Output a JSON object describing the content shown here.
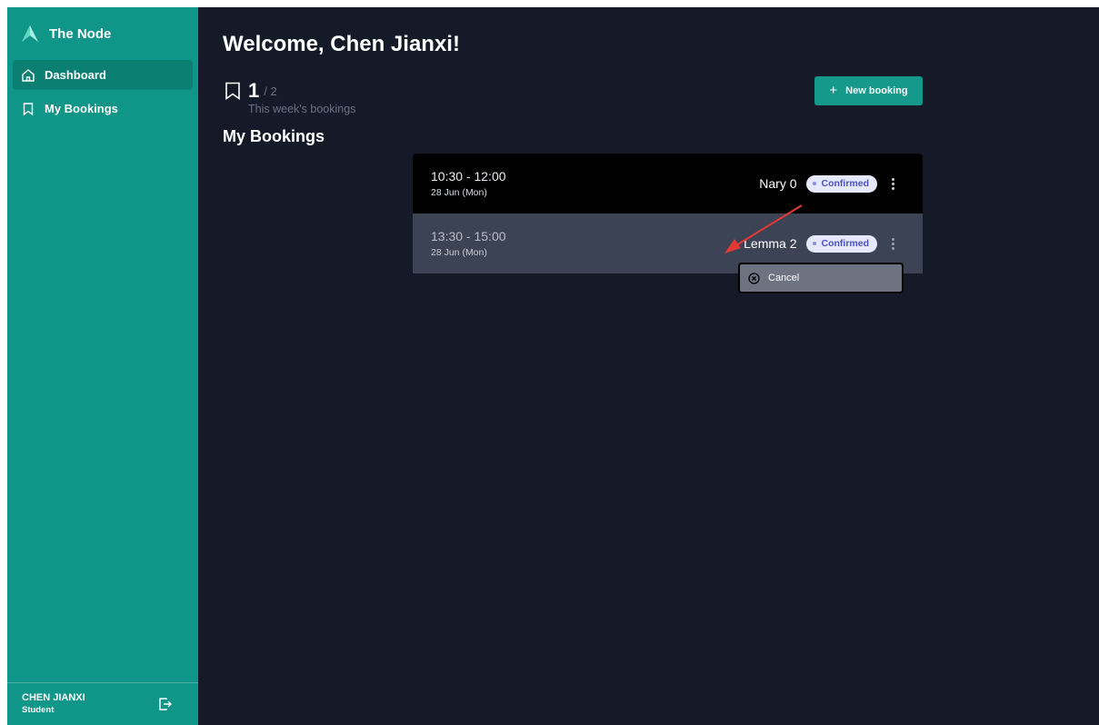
{
  "app": {
    "name": "The Node",
    "logo_icon": "a-logo-icon"
  },
  "sidebar": {
    "items": [
      {
        "label": "Dashboard",
        "icon": "home-icon",
        "active": true
      },
      {
        "label": "My Bookings",
        "icon": "bookmark-icon",
        "active": false
      }
    ],
    "user": {
      "name": "CHEN JIANXI",
      "role": "Student"
    },
    "logout_icon": "logout-icon"
  },
  "main": {
    "welcome": "Welcome, Chen Jianxi!",
    "stats": {
      "count": "1",
      "total": "/ 2",
      "caption": "This week's bookings"
    },
    "new_booking_label": "New booking",
    "section_title": "My Bookings",
    "bookings": [
      {
        "time": "10:30 - 12:00",
        "date": "28 Jun (Mon)",
        "room": "Nary 0",
        "status": "Confirmed"
      },
      {
        "time": "13:30 - 15:00",
        "date": "28 Jun (Mon)",
        "room": "Lemma 2",
        "status": "Confirmed"
      }
    ],
    "menu": {
      "cancel_label": "Cancel"
    }
  },
  "colors": {
    "sidebar": "#0f9688",
    "background": "#141a27",
    "accent_button": "#14998b",
    "badge_bg": "#e5e8ff",
    "badge_text": "#4a50c0",
    "annotation_arrow": "#e53935"
  }
}
